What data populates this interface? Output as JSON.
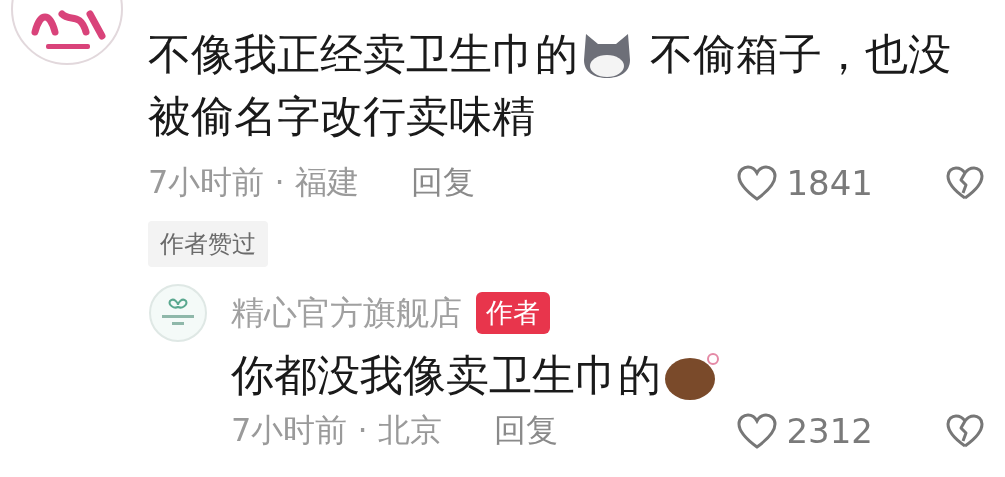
{
  "comment": {
    "body_lines": [
      [
        {
          "kind": "text",
          "text": "不像我正经卖卫生巾的"
        },
        {
          "kind": "sticker_husky"
        },
        {
          "kind": "text",
          "text": " 不偷箱子，也没"
        }
      ],
      [
        {
          "kind": "text",
          "text": "被偷名字改行卖味精"
        }
      ]
    ],
    "time_location": "7小时前 · 福建",
    "reply_label": "回复",
    "likes": "1841",
    "liked": false,
    "author_liked_tag": "作者赞过",
    "replies": [
      {
        "name": "精心官方旗舰店",
        "badge": "作者",
        "body_lines": [
          [
            {
              "kind": "text",
              "text": "你都没我像卖卫生巾的"
            },
            {
              "kind": "sticker_grin"
            }
          ]
        ],
        "time_location": "7小时前 · 北京",
        "reply_label": "回复",
        "likes": "2312",
        "liked": false
      }
    ]
  }
}
